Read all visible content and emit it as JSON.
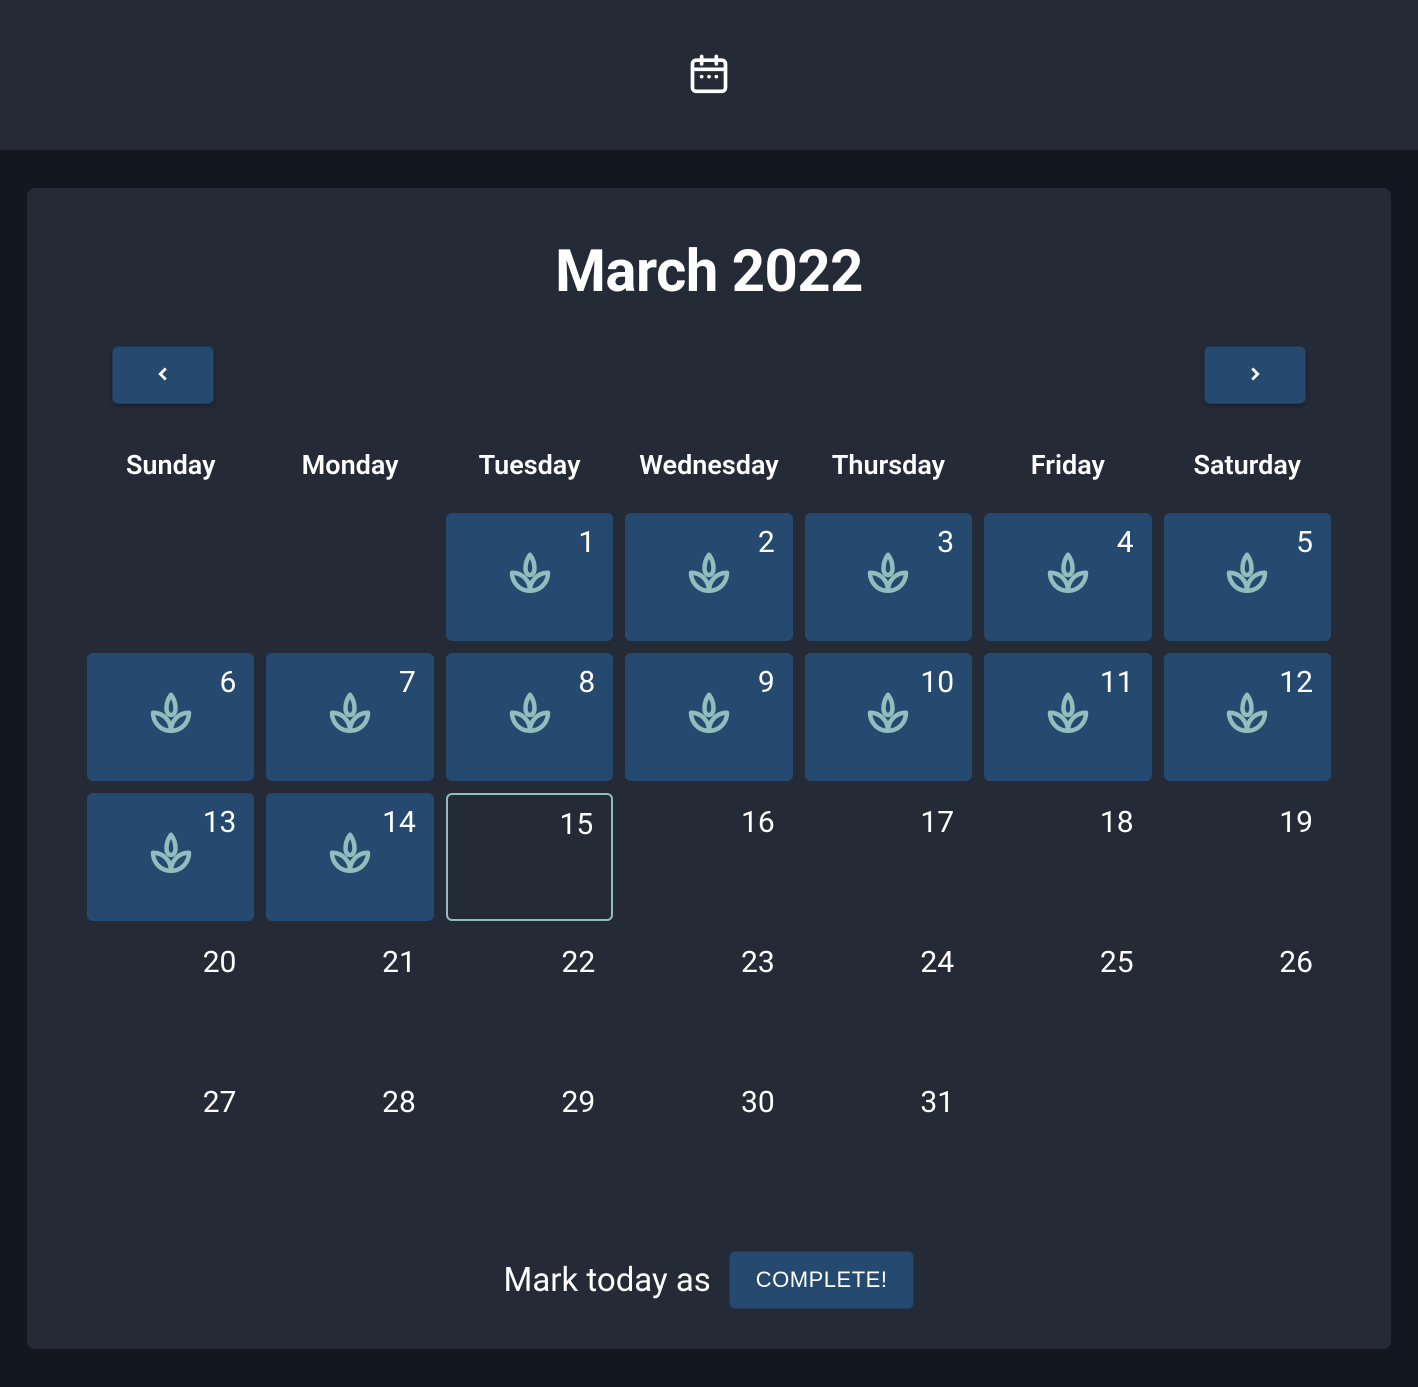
{
  "header": {
    "icon": "calendar-icon"
  },
  "calendar": {
    "month_title": "March 2022",
    "nav": {
      "prev_icon": "chevron-left-icon",
      "next_icon": "chevron-right-icon"
    },
    "day_headers": [
      "Sunday",
      "Monday",
      "Tuesday",
      "Wednesday",
      "Thursday",
      "Friday",
      "Saturday"
    ],
    "cells": [
      {
        "day": "",
        "state": "empty"
      },
      {
        "day": "",
        "state": "empty"
      },
      {
        "day": "1",
        "state": "completed"
      },
      {
        "day": "2",
        "state": "completed"
      },
      {
        "day": "3",
        "state": "completed"
      },
      {
        "day": "4",
        "state": "completed"
      },
      {
        "day": "5",
        "state": "completed"
      },
      {
        "day": "6",
        "state": "completed"
      },
      {
        "day": "7",
        "state": "completed"
      },
      {
        "day": "8",
        "state": "completed"
      },
      {
        "day": "9",
        "state": "completed"
      },
      {
        "day": "10",
        "state": "completed"
      },
      {
        "day": "11",
        "state": "completed"
      },
      {
        "day": "12",
        "state": "completed"
      },
      {
        "day": "13",
        "state": "completed"
      },
      {
        "day": "14",
        "state": "completed"
      },
      {
        "day": "15",
        "state": "today"
      },
      {
        "day": "16",
        "state": "future"
      },
      {
        "day": "17",
        "state": "future"
      },
      {
        "day": "18",
        "state": "future"
      },
      {
        "day": "19",
        "state": "future"
      },
      {
        "day": "20",
        "state": "future"
      },
      {
        "day": "21",
        "state": "future"
      },
      {
        "day": "22",
        "state": "future"
      },
      {
        "day": "23",
        "state": "future"
      },
      {
        "day": "24",
        "state": "future"
      },
      {
        "day": "25",
        "state": "future"
      },
      {
        "day": "26",
        "state": "future"
      },
      {
        "day": "27",
        "state": "future"
      },
      {
        "day": "28",
        "state": "future"
      },
      {
        "day": "29",
        "state": "future"
      },
      {
        "day": "30",
        "state": "future"
      },
      {
        "day": "31",
        "state": "future"
      },
      {
        "day": "",
        "state": "empty"
      },
      {
        "day": "",
        "state": "empty"
      }
    ]
  },
  "footer": {
    "label": "Mark today as",
    "button_label": "COMPLETE!"
  },
  "colors": {
    "bg_dark": "#13171f",
    "bg_card": "#252b36",
    "accent_blue": "#25496f",
    "icon_teal": "#91bdbd"
  }
}
